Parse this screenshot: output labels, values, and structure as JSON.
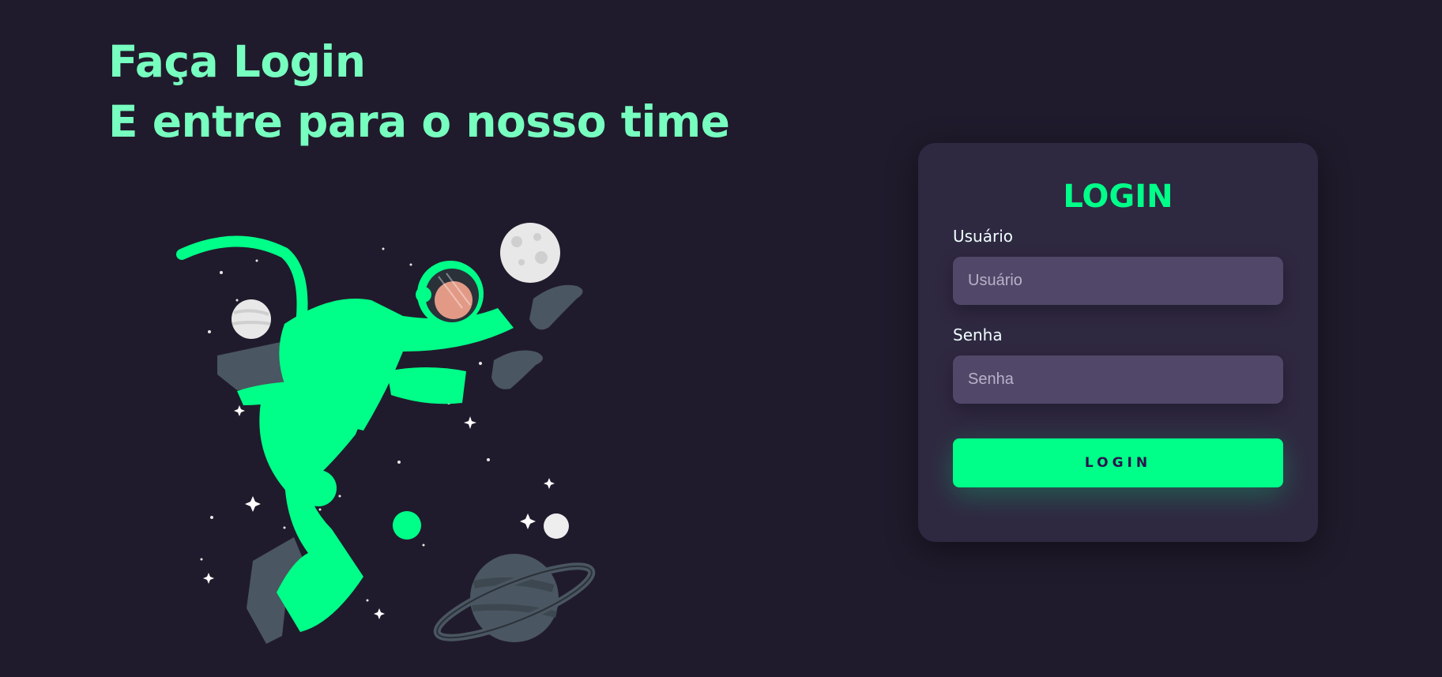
{
  "headline": {
    "line1": "Faça Login",
    "line2": "E entre para o nosso time"
  },
  "illustration": {
    "icon": "astronaut-illustration-icon"
  },
  "login_card": {
    "title": "LOGIN",
    "username": {
      "label": "Usuário",
      "placeholder": "Usuário",
      "value": ""
    },
    "password": {
      "label": "Senha",
      "placeholder": "Senha",
      "value": ""
    },
    "submit_label": "LOGIN"
  },
  "colors": {
    "background": "#201b2c",
    "card": "#2f2841",
    "input": "#514869",
    "accent": "#00ff88",
    "headline": "#77ffc0"
  }
}
